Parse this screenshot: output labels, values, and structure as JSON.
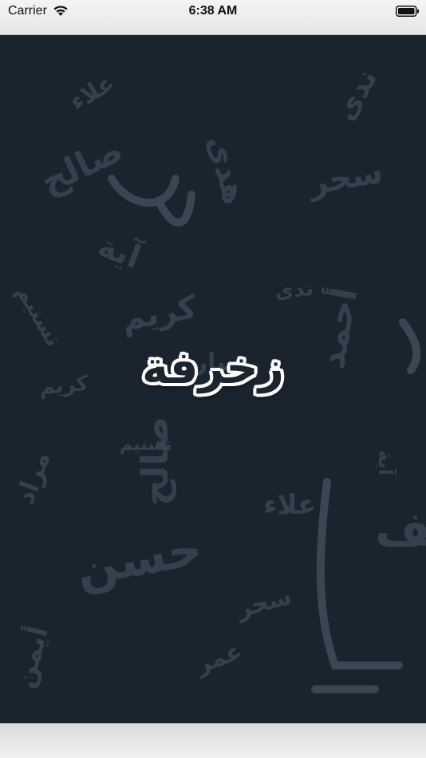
{
  "status_bar": {
    "carrier": "Carrier",
    "time": "6:38 AM",
    "wifi_icon": "wifi-icon",
    "battery_icon": "battery-icon"
  },
  "splash": {
    "logo_text": "زخرفة",
    "background_color": "#1a242f",
    "pattern_color": "#3a4652",
    "pattern_words": [
      "علاء",
      "صالح",
      "سحر",
      "آية",
      "تسنيم",
      "ندى",
      "كريم",
      "أحمد",
      "سارة",
      "عمر",
      "مراد",
      "حسن",
      "أيمن",
      "يوسف",
      "هدى"
    ]
  }
}
